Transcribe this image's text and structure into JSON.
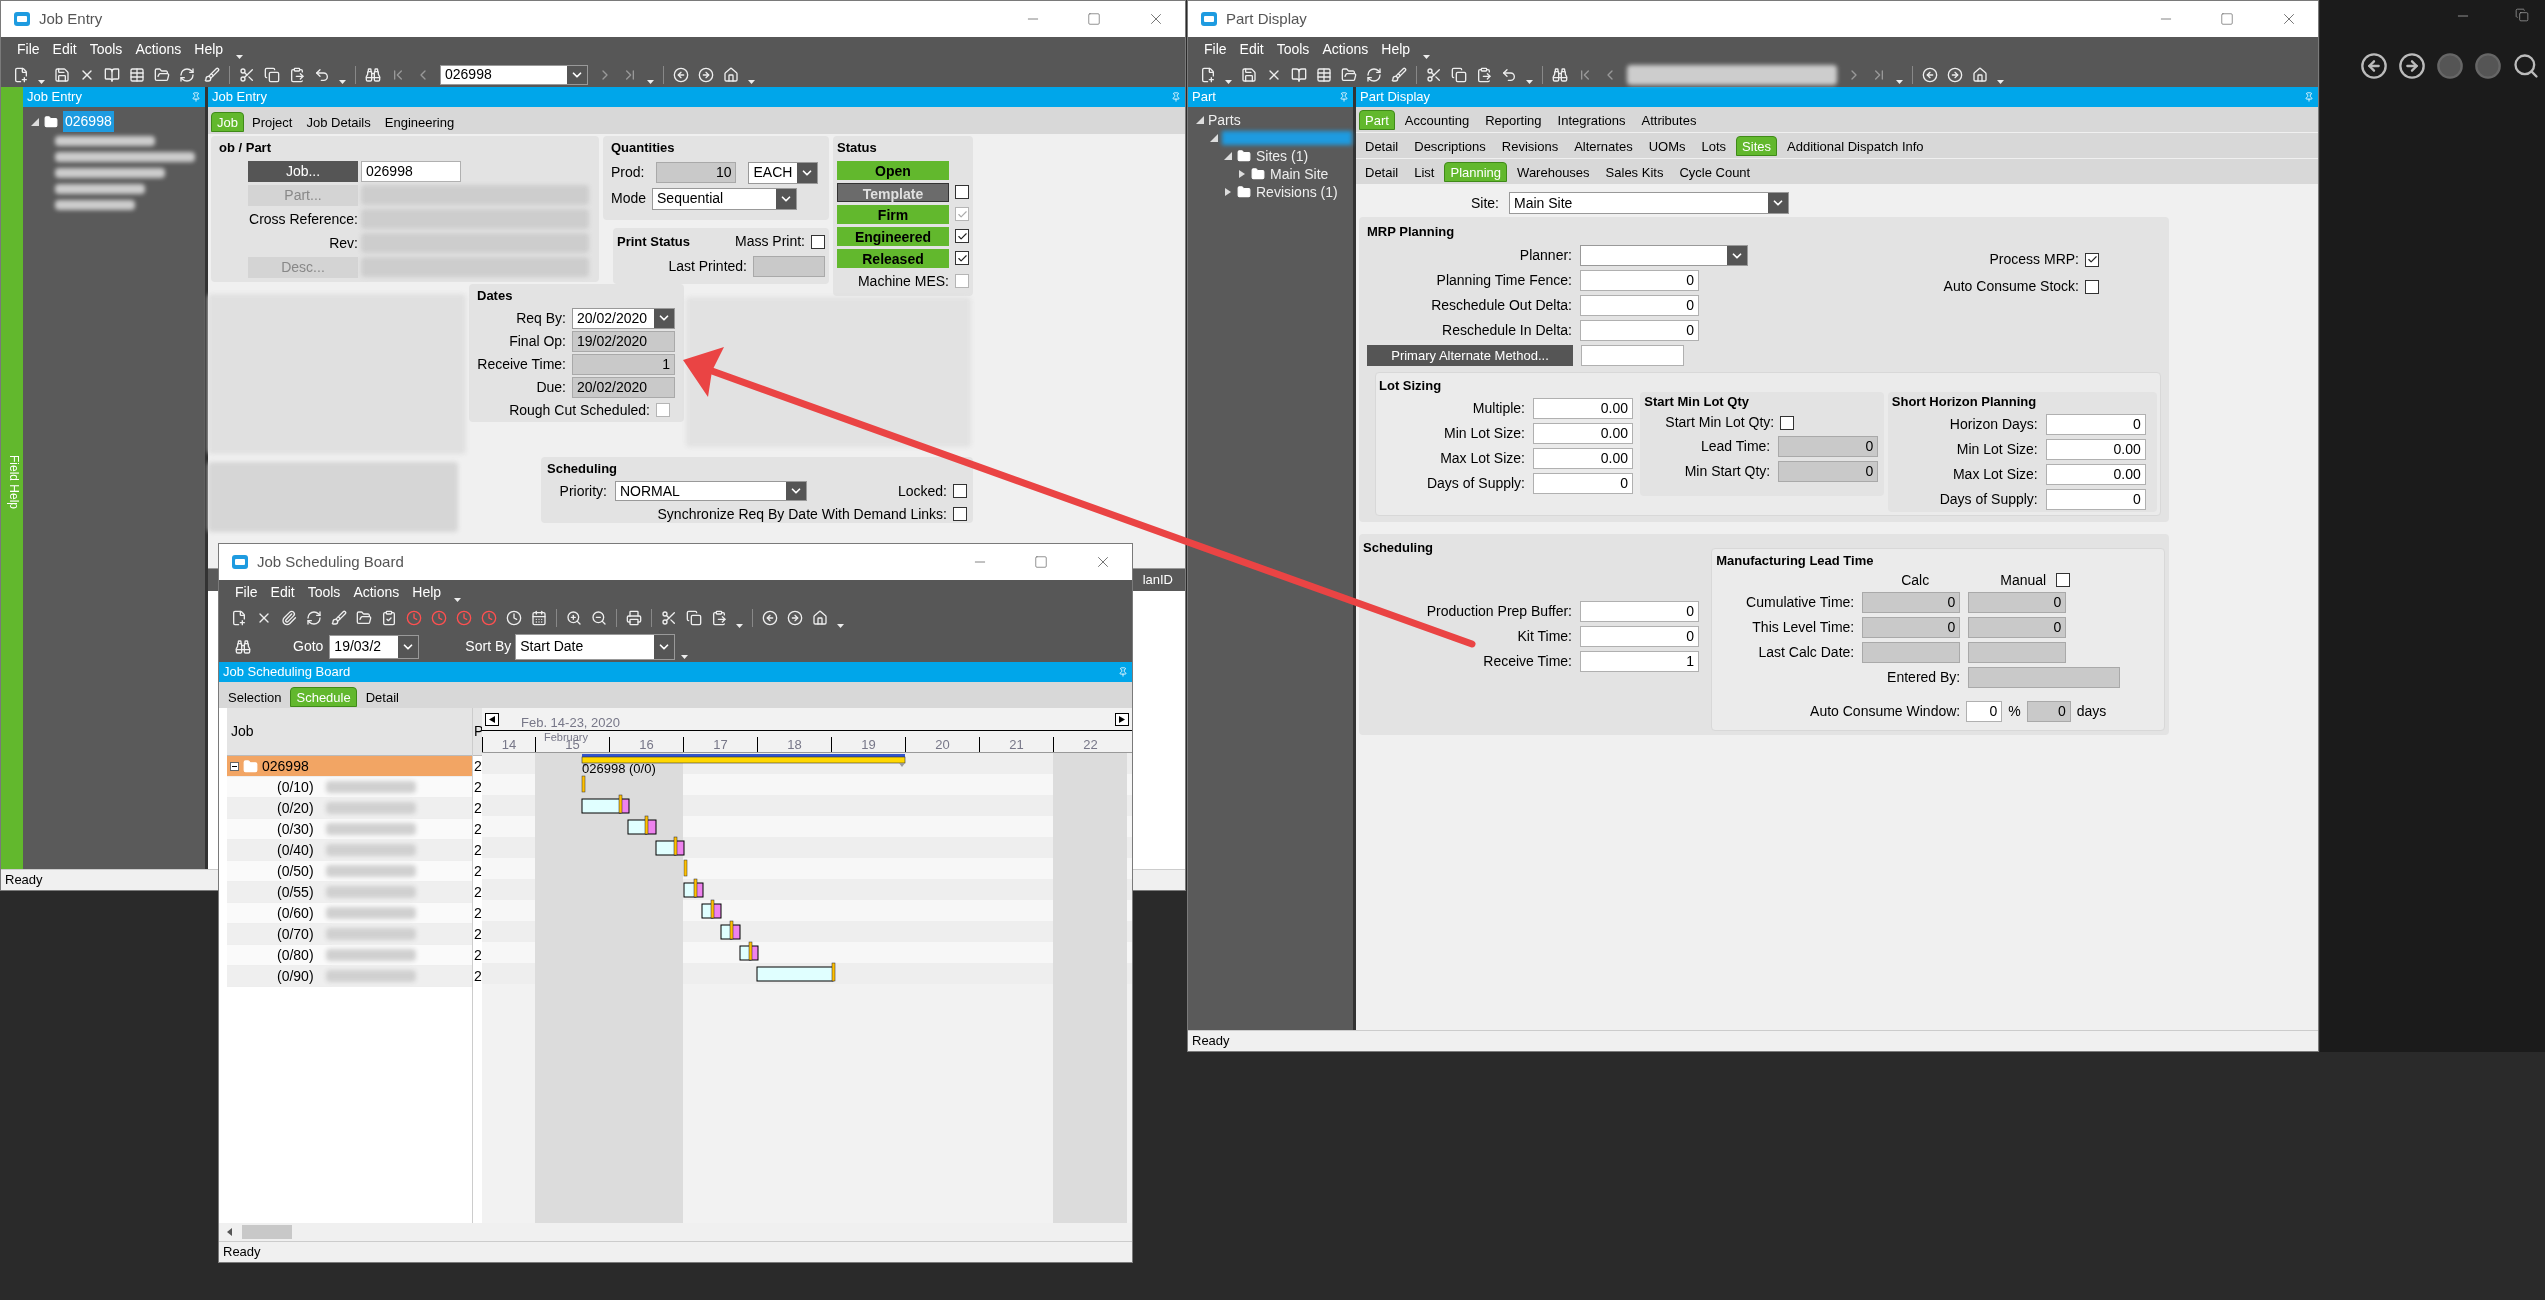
{
  "job_entry": {
    "title": "Job Entry",
    "menu": [
      "File",
      "Edit",
      "Tools",
      "Actions",
      "Help"
    ],
    "record": "026998",
    "field_help": "Field Help",
    "tree": {
      "title": "Job Entry",
      "items": [
        {
          "label": "026998",
          "selected": true,
          "expanded": true
        }
      ]
    },
    "panel_title": "Job Entry",
    "tabs": [
      {
        "label": "Job",
        "selected": true
      },
      {
        "label": "Project",
        "selected": false
      },
      {
        "label": "Job Details",
        "selected": false
      },
      {
        "label": "Engineering",
        "selected": false
      }
    ],
    "job_part": {
      "title": "ob / Part",
      "job_button": "Job...",
      "job": "026998",
      "part_button": "Part...",
      "cross_reference": "Cross Reference:",
      "rev": "Rev:",
      "desc_button": "Desc..."
    },
    "quantities": {
      "title": "Quantities",
      "prod_label": "Prod:",
      "prod": "10",
      "uom": "EACH",
      "mode_label": "Mode",
      "mode": "Sequential"
    },
    "print_status": {
      "title": "Print Status",
      "mass_print": {
        "label": "Mass Print:",
        "checked": false
      },
      "last_printed_label": "Last Printed:"
    },
    "status": {
      "title": "Status",
      "items": [
        {
          "label": "Open",
          "kind": "button",
          "active": true
        },
        {
          "label": "Template",
          "kind": "check",
          "active": false,
          "checked": false,
          "disabled": false
        },
        {
          "label": "Firm",
          "kind": "check",
          "active": true,
          "checked": true,
          "disabled": true
        },
        {
          "label": "Engineered",
          "kind": "check",
          "active": true,
          "checked": true,
          "disabled": false
        },
        {
          "label": "Released",
          "kind": "check",
          "active": true,
          "checked": true,
          "disabled": false
        },
        {
          "label": "Machine MES:",
          "kind": "label",
          "checked": false,
          "disabled": true
        }
      ]
    },
    "dates": {
      "title": "Dates",
      "rows": [
        {
          "label": "Req By:",
          "value": "20/02/2020",
          "kind": "dropdown"
        },
        {
          "label": "Final Op:",
          "value": "19/02/2020",
          "kind": "readonly"
        },
        {
          "label": "Receive Time:",
          "value": "1",
          "kind": "readonly"
        },
        {
          "label": "Due:",
          "value": "20/02/2020",
          "kind": "readonly"
        }
      ],
      "rough_cut": {
        "label": "Rough Cut Scheduled:",
        "checked": false
      }
    },
    "scheduling": {
      "title": "Scheduling",
      "priority_label": "Priority:",
      "priority": "NORMAL",
      "locked": {
        "label": "Locked:",
        "checked": false
      },
      "synchronize": {
        "label": "Synchronize Req By Date With Demand Links:",
        "checked": false
      }
    },
    "grid_header": "lanID",
    "status_bar": "Ready"
  },
  "part_display": {
    "title": "Part Display",
    "menu": [
      "File",
      "Edit",
      "Tools",
      "Actions",
      "Help"
    ],
    "tree": {
      "title": "Part",
      "items": [
        {
          "label": "Parts",
          "expanded": true,
          "selected": false,
          "children": [
            {
              "blurred": true,
              "expanded": true,
              "selected": true,
              "children": [
                {
                  "label": "Sites (1)",
                  "expanded": true,
                  "selected": false,
                  "children": [
                    {
                      "label": "Main Site",
                      "expanded": false,
                      "selected": false
                    }
                  ]
                },
                {
                  "label": "Revisions (1)",
                  "expanded": false,
                  "selected": false
                }
              ]
            }
          ]
        }
      ]
    },
    "panel_title": "Part Display",
    "tab_rows": [
      [
        {
          "label": "Part",
          "selected": true
        },
        {
          "label": "Accounting",
          "selected": false
        },
        {
          "label": "Reporting",
          "selected": false
        },
        {
          "label": "Integrations",
          "selected": false
        },
        {
          "label": "Attributes",
          "selected": false
        }
      ],
      [
        {
          "label": "Detail",
          "selected": false
        },
        {
          "label": "Descriptions",
          "selected": false
        },
        {
          "label": "Revisions",
          "selected": false
        },
        {
          "label": "Alternates",
          "selected": false
        },
        {
          "label": "UOMs",
          "selected": false
        },
        {
          "label": "Lots",
          "selected": false
        },
        {
          "label": "Sites",
          "selected": true
        },
        {
          "label": "Additional Dispatch Info",
          "selected": false
        }
      ],
      [
        {
          "label": "Detail",
          "selected": false
        },
        {
          "label": "List",
          "selected": false
        },
        {
          "label": "Planning",
          "selected": true
        },
        {
          "label": "Warehouses",
          "selected": false
        },
        {
          "label": "Sales Kits",
          "selected": false
        },
        {
          "label": "Cycle Count",
          "selected": false
        }
      ]
    ],
    "site": {
      "label": "Site:",
      "value": "Main Site"
    },
    "mrp": {
      "title": "MRP Planning",
      "planner_label": "Planner:",
      "fields": [
        {
          "label": "Planning Time Fence:",
          "value": "0"
        },
        {
          "label": "Reschedule Out Delta:",
          "value": "0"
        },
        {
          "label": "Reschedule In Delta:",
          "value": "0"
        }
      ],
      "primary_alternate_button": "Primary Alternate Method...",
      "process_mrp": {
        "label": "Process MRP:",
        "checked": true
      },
      "auto_consume_stock": {
        "label": "Auto Consume Stock:",
        "checked": false
      },
      "lot_sizing": {
        "title": "Lot Sizing",
        "fields": [
          {
            "label": "Multiple:",
            "value": "0.00"
          },
          {
            "label": "Min Lot Size:",
            "value": "0.00"
          },
          {
            "label": "Max Lot Size:",
            "value": "0.00"
          },
          {
            "label": "Days of Supply:",
            "value": "0"
          }
        ]
      },
      "start_min_lot_qty": {
        "title": "Start Min Lot Qty",
        "checkbox": {
          "label": "Start Min Lot Qty:",
          "checked": false
        },
        "fields": [
          {
            "label": "Lead Time:",
            "value": "0"
          },
          {
            "label": "Min Start Qty:",
            "value": "0"
          }
        ]
      },
      "short_horizon": {
        "title": "Short Horizon Planning",
        "fields": [
          {
            "label": "Horizon Days:",
            "value": "0"
          },
          {
            "label": "Min Lot Size:",
            "value": "0.00"
          },
          {
            "label": "Max Lot Size:",
            "value": "0.00"
          },
          {
            "label": "Days of Supply:",
            "value": "0"
          }
        ]
      }
    },
    "scheduling": {
      "title": "Scheduling",
      "fields": [
        {
          "label": "Production Prep Buffer:",
          "value": "0"
        },
        {
          "label": "Kit Time:",
          "value": "0"
        },
        {
          "label": "Receive Time:",
          "value": "1"
        }
      ]
    },
    "lead_time": {
      "title": "Manufacturing Lead Time",
      "calc_header": "Calc",
      "manual": {
        "label": "Manual",
        "checked": false
      },
      "rows": [
        {
          "label": "Cumulative Time:",
          "calc": "0",
          "manual": "0"
        },
        {
          "label": "This Level Time:",
          "calc": "0",
          "manual": "0"
        },
        {
          "label": "Last Calc Date:"
        }
      ],
      "entered_by": "Entered By:",
      "auto_consume": {
        "label": "Auto Consume Window:",
        "value": "0",
        "percent": "%",
        "days_value": "0",
        "days": "days"
      }
    },
    "status_bar": "Ready"
  },
  "scheduling_board": {
    "title": "Job Scheduling Board",
    "menu": [
      "File",
      "Edit",
      "Tools",
      "Actions",
      "Help"
    ],
    "goto_label": "Goto",
    "goto": "19/03/2",
    "sort_label": "Sort By",
    "sort": "Start Date",
    "panel_title": "Job Scheduling Board",
    "tabs": [
      {
        "label": "Selection",
        "selected": false
      },
      {
        "label": "Schedule",
        "selected": true
      },
      {
        "label": "Detail",
        "selected": false
      }
    ],
    "columns": [
      "Job",
      "P"
    ],
    "rows": [
      {
        "job": "026998",
        "col2": "2",
        "kind": "job",
        "expanded": true,
        "selected": true
      },
      {
        "job": "(0/10)",
        "col2": "2",
        "kind": "operation",
        "selected": false
      },
      {
        "job": "(0/20)",
        "col2": "2",
        "kind": "operation",
        "selected": false
      },
      {
        "job": "(0/30)",
        "col2": "2",
        "kind": "operation",
        "selected": false
      },
      {
        "job": "(0/40)",
        "col2": "2",
        "kind": "operation",
        "selected": false
      },
      {
        "job": "(0/50)",
        "col2": "2",
        "kind": "operation",
        "selected": false
      },
      {
        "job": "(0/55)",
        "col2": "2",
        "kind": "operation",
        "selected": false
      },
      {
        "job": "(0/60)",
        "col2": "2",
        "kind": "operation",
        "selected": false
      },
      {
        "job": "(0/70)",
        "col2": "2",
        "kind": "operation",
        "selected": false
      },
      {
        "job": "(0/80)",
        "col2": "2",
        "kind": "operation",
        "selected": false
      },
      {
        "job": "(0/90)",
        "col2": "2",
        "kind": "operation",
        "selected": false
      }
    ],
    "gantt": {
      "range": "Feb. 14-23, 2020",
      "month": "February",
      "days": [
        "14",
        "15",
        "16",
        "17",
        "18",
        "19",
        "20",
        "21",
        "22"
      ],
      "bar_label": "026998 (0/0)"
    },
    "status_bar": "Ready"
  }
}
